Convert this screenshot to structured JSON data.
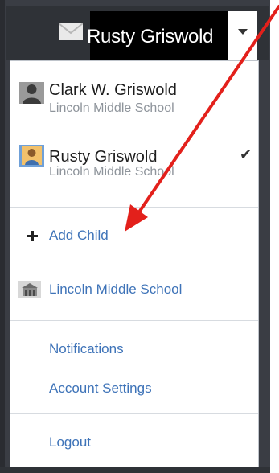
{
  "header": {
    "user_name": "Rusty Griswold",
    "icons": {
      "mail": "mail-icon",
      "caret": "caret-down-icon"
    }
  },
  "menu": {
    "accounts": [
      {
        "name": "Clark W. Griswold",
        "school": "Lincoln Middle School",
        "icon": "person-silhouette-icon",
        "selected": false
      },
      {
        "name": "Rusty Griswold",
        "school": "Lincoln Middle School",
        "icon": "student-photo-icon",
        "selected": true
      }
    ],
    "selected_mark": "✔",
    "add_child": {
      "label": "Add Child",
      "icon": "plus-icon"
    },
    "school_link": {
      "label": "Lincoln Middle School",
      "icon": "school-building-icon"
    },
    "notifications_label": "Notifications",
    "account_settings_label": "Account Settings",
    "logout_label": "Logout"
  },
  "annotation": {
    "color": "#e3201b",
    "icon": "red-arrow-annotation"
  },
  "colors": {
    "link": "#3e73b8",
    "header_bg": "#000000",
    "subtext": "#8e949b"
  }
}
